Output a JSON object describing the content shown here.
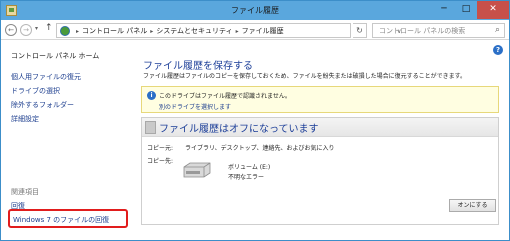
{
  "window": {
    "title": "ファイル履歴",
    "minimize_glyph": "─",
    "maximize_glyph": "□",
    "close_glyph": "✕"
  },
  "addressbar": {
    "back_glyph": "←",
    "forward_glyph": "→",
    "dropdown_glyph": "▾",
    "up_glyph": "↑",
    "crumb_sep": "▸",
    "breadcrumbs": [
      "コントロール パネル",
      "システムとセキュリティ",
      "ファイル履歴"
    ],
    "chevron_glyph": "∨",
    "refresh_glyph": "↻",
    "search_placeholder": "コントロール パネルの検索",
    "search_glyph": "⌕"
  },
  "sidebar": {
    "home": "コントロール パネル ホーム",
    "links": [
      "個人用ファイルの復元",
      "ドライブの選択",
      "除外するフォルダー",
      "詳細設定"
    ],
    "related_heading": "関連項目",
    "related": [
      "回復",
      "Windows 7 のファイルの回復"
    ]
  },
  "main": {
    "help_glyph": "?",
    "heading": "ファイル履歴を保存する",
    "description": "ファイル履歴はファイルのコピーを保存しておくため、ファイルを紛失または破損した場合に復元することができます。",
    "info": {
      "icon_glyph": "i",
      "text": "このドライブはファイル履歴で認識されません。",
      "link": "別のドライブを選択します"
    },
    "status": {
      "title": "ファイル履歴はオフになっています",
      "copy_from_label": "コピー元:",
      "copy_from_value": "ライブラリ、デスクトップ、連絡先、およびお気に入り",
      "copy_to_label": "コピー先:",
      "drive_name": "ボリューム (E:)",
      "drive_status": "不明なエラー"
    },
    "turn_on_button": "オンにする"
  },
  "colors": {
    "titlebar": "#5aa7dd",
    "heading": "#1d3f99",
    "link": "#1e3f8f",
    "highlight": "#e11d1d",
    "info_bg": "#fffee1"
  }
}
